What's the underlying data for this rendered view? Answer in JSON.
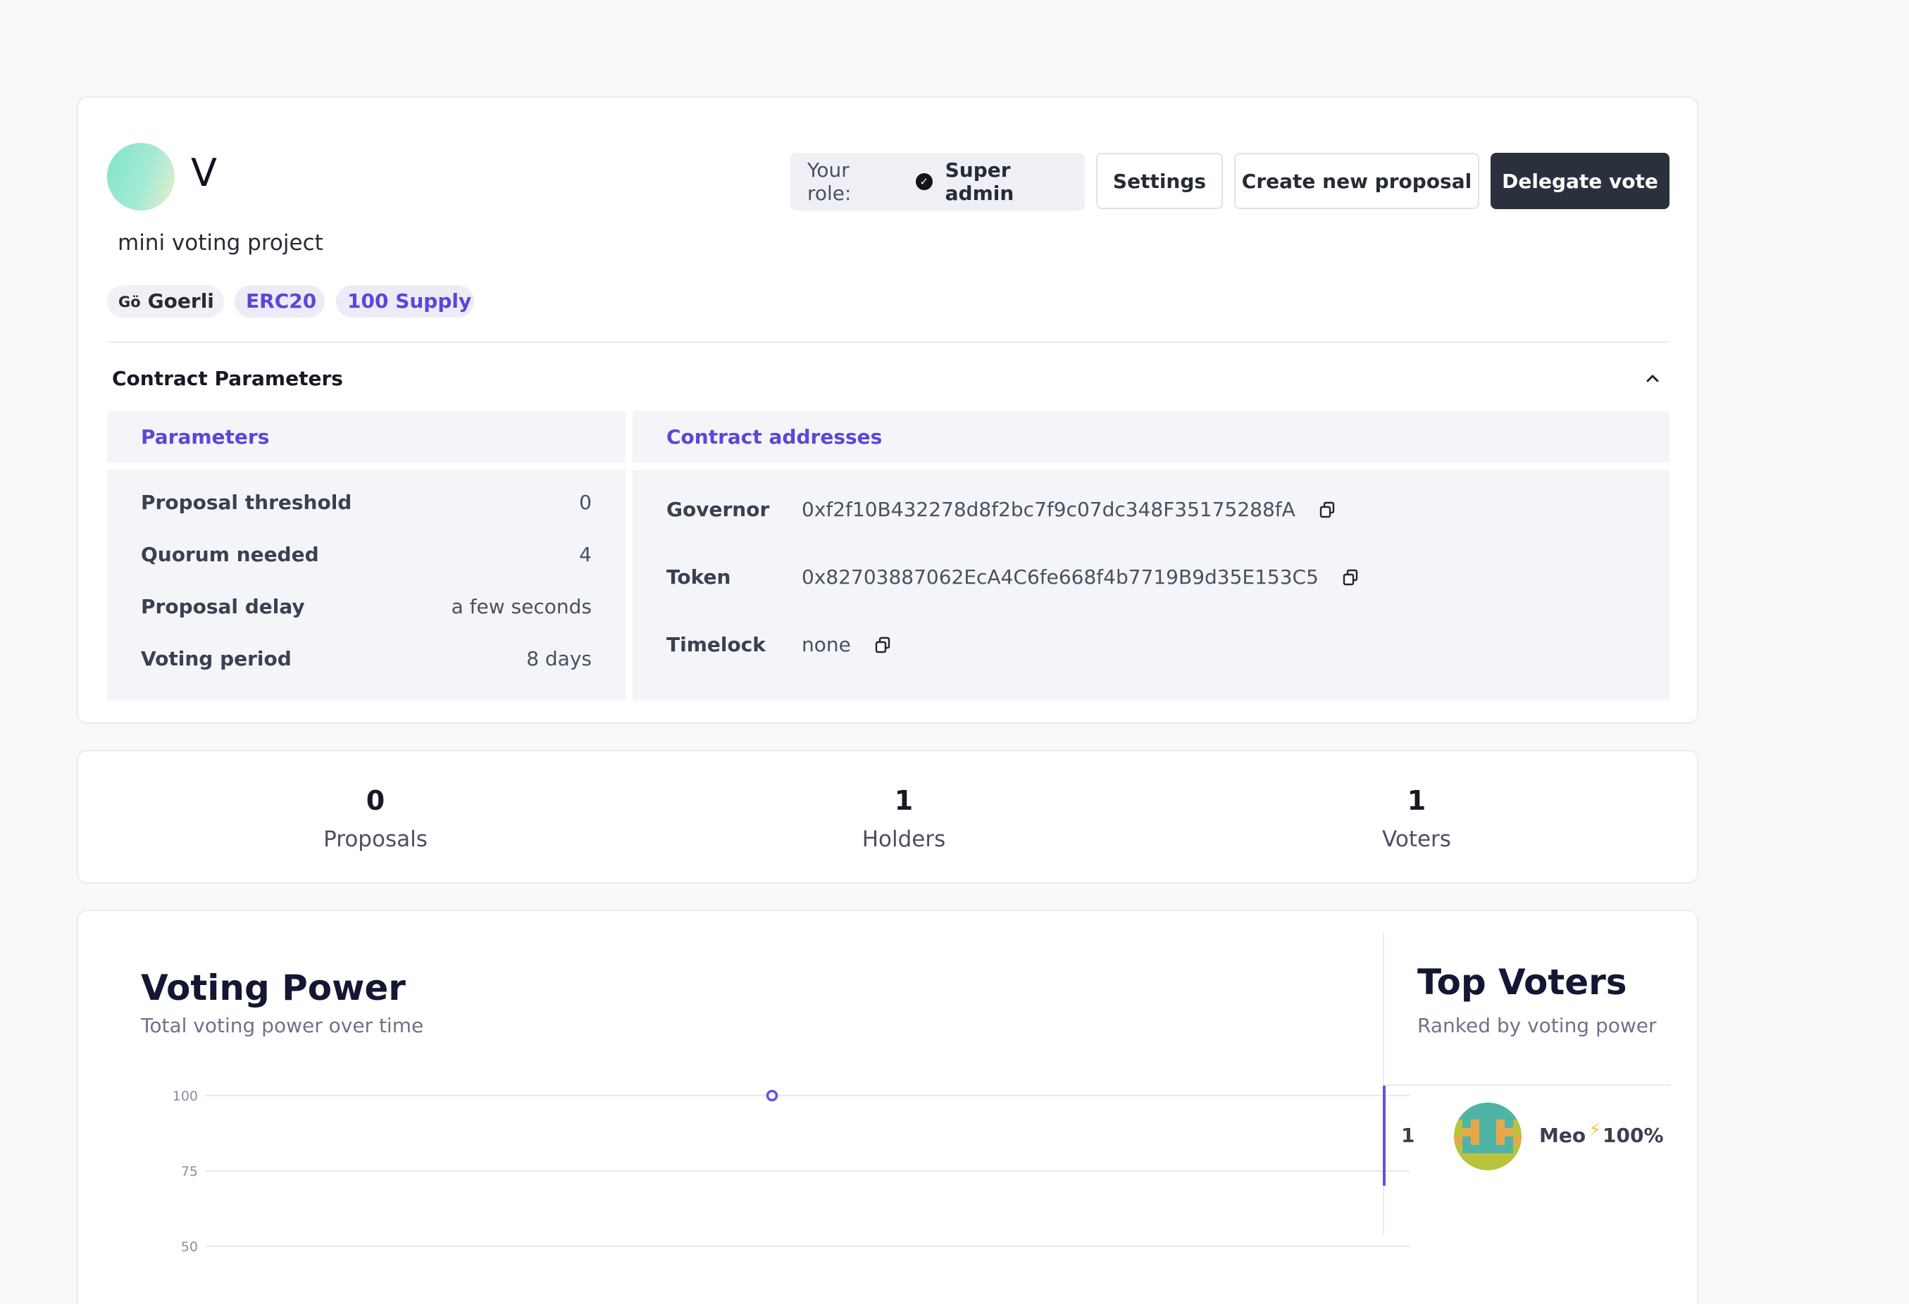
{
  "dao": {
    "initial": "V",
    "description": "mini voting project",
    "tags": {
      "network": "Goerli",
      "network_glyph": "Gö",
      "standard": "ERC20",
      "supply": "100 Supply"
    }
  },
  "header": {
    "role_label": "Your role:",
    "role_value": "Super admin",
    "settings_label": "Settings",
    "create_label": "Create new proposal",
    "delegate_label": "Delegate vote"
  },
  "contract": {
    "section_title": "Contract Parameters",
    "parameters_title": "Parameters",
    "addresses_title": "Contract addresses",
    "parameters": [
      {
        "label": "Proposal threshold",
        "value": "0"
      },
      {
        "label": "Quorum needed",
        "value": "4"
      },
      {
        "label": "Proposal delay",
        "value": "a few seconds"
      },
      {
        "label": "Voting period",
        "value": "8 days"
      }
    ],
    "addresses": [
      {
        "label": "Governor",
        "value": "0xf2f10B432278d8f2bc7f9c07dc348F35175288fA"
      },
      {
        "label": "Token",
        "value": "0x82703887062EcA4C6fe668f4b7719B9d35E153C5"
      },
      {
        "label": "Timelock",
        "value": "none"
      }
    ]
  },
  "stats": [
    {
      "value": "0",
      "label": "Proposals"
    },
    {
      "value": "1",
      "label": "Holders"
    },
    {
      "value": "1",
      "label": "Voters"
    }
  ],
  "voting_power": {
    "title": "Voting Power",
    "subtitle": "Total voting power over time"
  },
  "top_voters": {
    "title": "Top Voters",
    "subtitle": "Ranked by voting power",
    "list": [
      {
        "rank": "1",
        "name": "Meo",
        "percent": "100%"
      }
    ]
  },
  "chart_data": {
    "type": "line",
    "title": "Voting Power",
    "xlabel": "",
    "ylabel": "",
    "yticks": [
      "100",
      "75",
      "50"
    ],
    "ylim": [
      50,
      100
    ],
    "series": [
      {
        "values": [
          100
        ]
      }
    ],
    "grid": true,
    "accent_color": "#6a4fe0"
  },
  "colors": {
    "accent": "#5c46d8",
    "dark_button": "#2b303d"
  }
}
